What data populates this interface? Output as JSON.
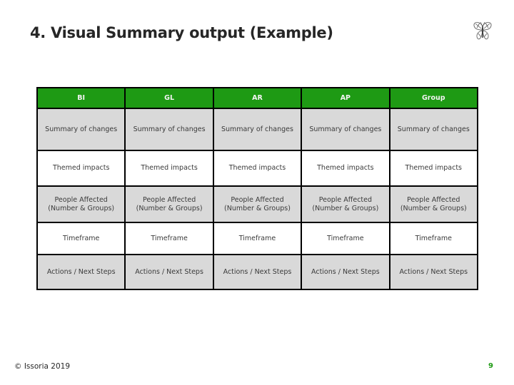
{
  "slide": {
    "title": "4. Visual Summary output (Example)",
    "logo_icon": "butterfly-icon",
    "footer": "© Issoria 2019",
    "page_number": "9",
    "accent_color": "#1e9a14"
  },
  "table": {
    "headers": [
      "BI",
      "GL",
      "AR",
      "AP",
      "Group"
    ],
    "rows": [
      [
        "Summary of changes",
        "Summary of changes",
        "Summary of changes",
        "Summary of changes",
        "Summary of changes"
      ],
      [
        "Themed impacts",
        "Themed impacts",
        "Themed impacts",
        "Themed impacts",
        "Themed impacts"
      ],
      [
        "People Affected (Number & Groups)",
        "People Affected (Number & Groups)",
        "People Affected (Number & Groups)",
        "People Affected (Number & Groups)",
        "People Affected (Number & Groups)"
      ],
      [
        "Timeframe",
        "Timeframe",
        "Timeframe",
        "Timeframe",
        "Timeframe"
      ],
      [
        "Actions / Next Steps",
        "Actions / Next Steps",
        "Actions / Next Steps",
        "Actions / Next Steps",
        "Actions / Next Steps"
      ]
    ]
  }
}
